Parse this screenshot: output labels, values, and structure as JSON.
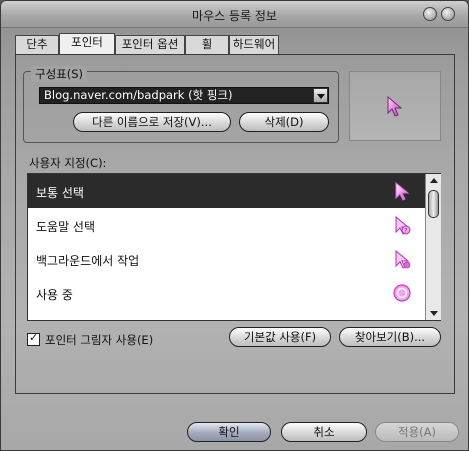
{
  "window": {
    "title": "마우스 등록 정보"
  },
  "tabs": [
    {
      "label": "단추"
    },
    {
      "label": "포인터"
    },
    {
      "label": "포인터 옵션"
    },
    {
      "label": "휠"
    },
    {
      "label": "하드웨어"
    }
  ],
  "active_tab": "포인터",
  "scheme": {
    "group_label": "구성표(S)",
    "selected_value": "Blog.naver.com/badpark (핫 핑크)",
    "save_as_label": "다른 이름으로 저장(V)...",
    "delete_label": "삭제(D)"
  },
  "customize": {
    "label": "사용자 지정(C):",
    "items": [
      {
        "label": "보통 선택",
        "icon": "arrow-cursor-icon",
        "selected": true
      },
      {
        "label": "도움말 선택",
        "icon": "help-cursor-icon",
        "selected": false
      },
      {
        "label": "백그라운드에서 작업",
        "icon": "working-in-background-cursor-icon",
        "selected": false
      },
      {
        "label": "사용 중",
        "icon": "busy-cursor-icon",
        "selected": false
      }
    ]
  },
  "options": {
    "shadow_label": "포인터 그림자 사용(E)",
    "shadow_checked": true,
    "default_label": "기본값 사용(F)",
    "browse_label": "찾아보기(B)..."
  },
  "footer": {
    "ok_label": "확인",
    "cancel_label": "취소",
    "apply_label": "적용(A)"
  },
  "colors": {
    "accent_pink": "#e36ad8",
    "selection_bg": "#2b2b2b"
  }
}
